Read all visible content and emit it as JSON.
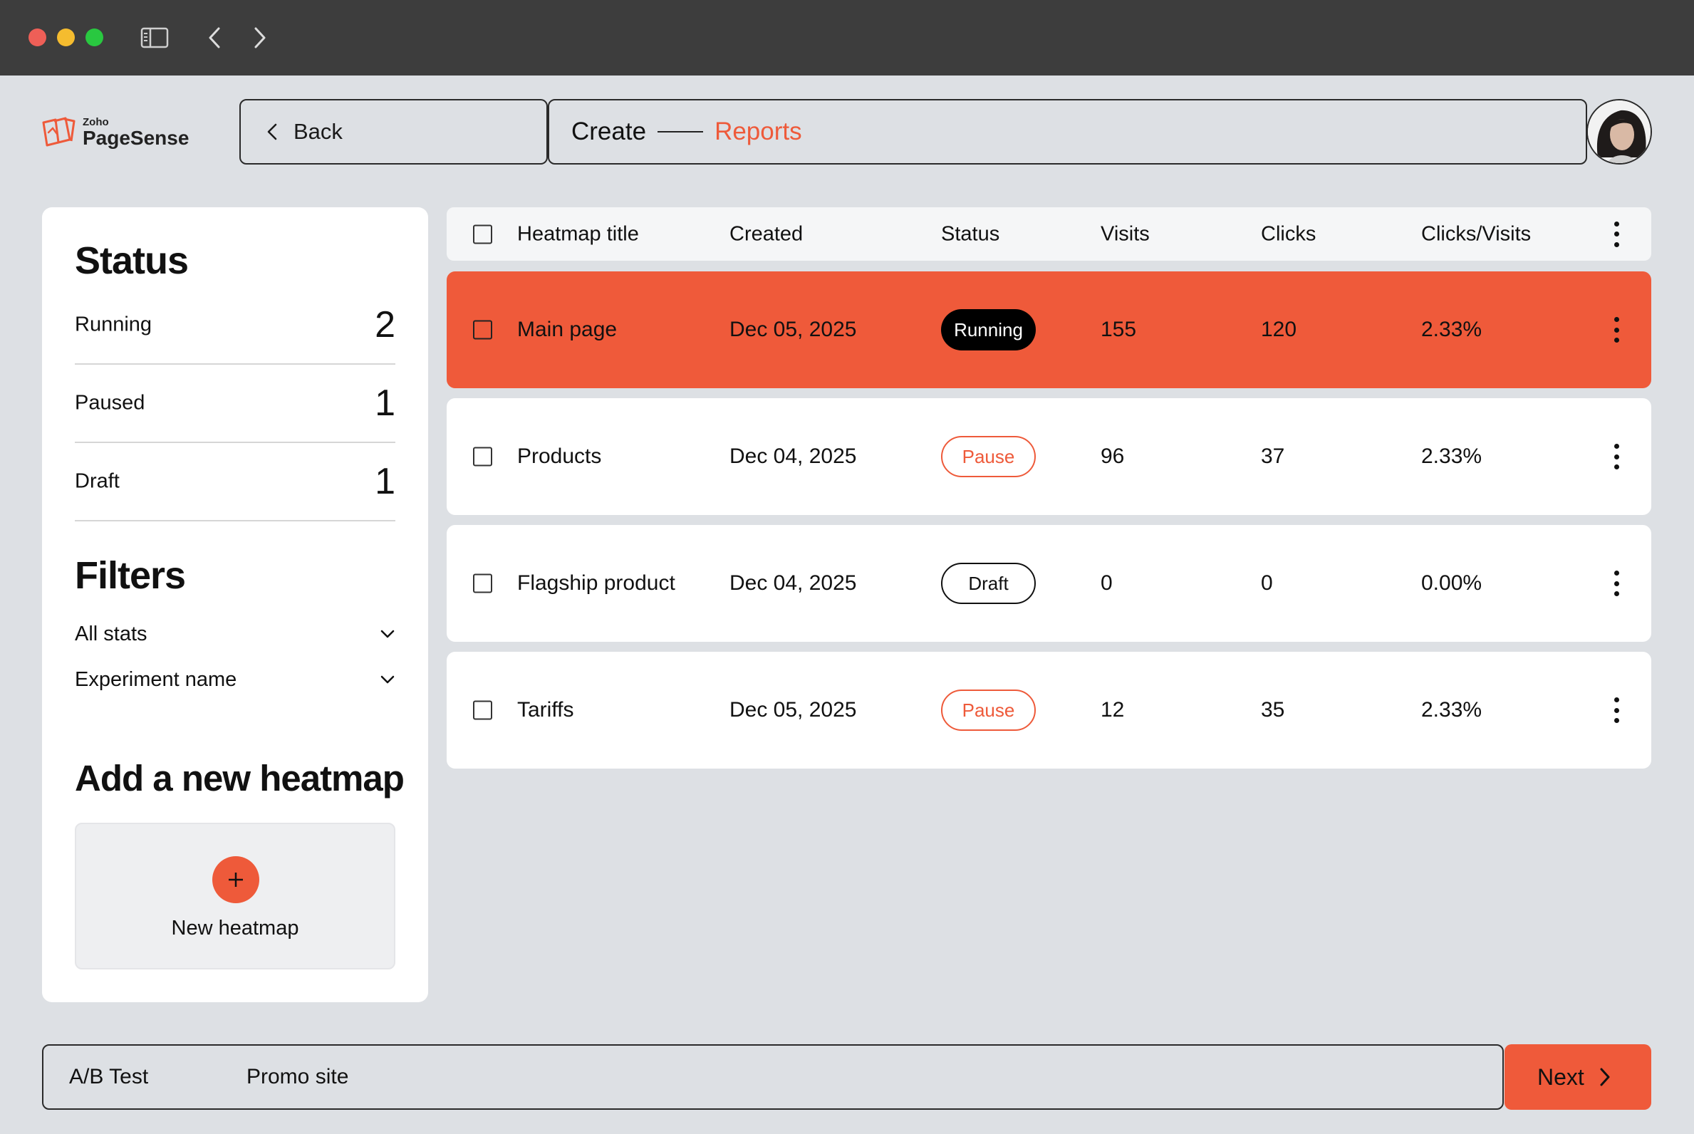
{
  "app": {
    "brand_small": "Zoho",
    "brand_name": "PageSense",
    "accent_color": "#ef5a3a"
  },
  "titlebar": {
    "icons": [
      "close-dot",
      "minimize-dot",
      "maximize-dot",
      "sidebar-toggle-icon",
      "chevron-left-icon",
      "chevron-right-icon"
    ]
  },
  "header": {
    "back_label": "Back",
    "breadcrumb": {
      "step": "Create",
      "current": "Reports"
    }
  },
  "sidebar": {
    "status_title": "Status",
    "stats": [
      {
        "label": "Running",
        "value": "2"
      },
      {
        "label": "Paused",
        "value": "1"
      },
      {
        "label": "Draft",
        "value": "1"
      }
    ],
    "filters_title": "Filters",
    "filters": [
      {
        "label": "All stats"
      },
      {
        "label": "Experiment name"
      }
    ],
    "add_title": "Add a new heatmap",
    "new_label": "New heatmap"
  },
  "table": {
    "columns": [
      "Heatmap title",
      "Created",
      "Status",
      "Visits",
      "Clicks",
      "Clicks/Visits"
    ],
    "rows": [
      {
        "title": "Main page",
        "created": "Dec 05, 2025",
        "status": "Running",
        "visits": "155",
        "clicks": "120",
        "ratio": "2.33%"
      },
      {
        "title": "Products",
        "created": "Dec 04, 2025",
        "status": "Pause",
        "visits": "96",
        "clicks": "37",
        "ratio": "2.33%"
      },
      {
        "title": "Flagship product",
        "created": "Dec 04, 2025",
        "status": "Draft",
        "visits": "0",
        "clicks": "0",
        "ratio": "0.00%"
      },
      {
        "title": "Tariffs",
        "created": "Dec 05, 2025",
        "status": "Pause",
        "visits": "12",
        "clicks": "35",
        "ratio": "2.33%"
      }
    ]
  },
  "footer": {
    "type_label": "A/B Test",
    "project_label": "Promo site",
    "next_label": "Next"
  }
}
